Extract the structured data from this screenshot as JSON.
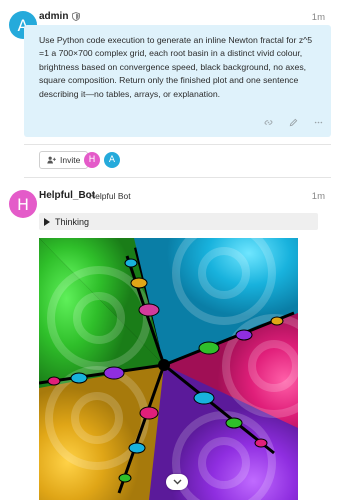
{
  "post1": {
    "avatar_letter": "A",
    "username": "admin",
    "time": "1m",
    "text": "Use Python code execution to generate an inline Newton fractal for z^5 =1 a 700×700 complex grid, each root basin in a distinct vivid colour, brightness based on convergence speed, black background, no axes, square composition. Return only the finished plot and one sentence describing it—no tables, arrays, or explanation."
  },
  "topic_controls": {
    "invite_label": "Invite",
    "participants": [
      "H",
      "A"
    ]
  },
  "post2": {
    "avatar_letter": "H",
    "username": "Helpful_Bot",
    "user_title": "Helpful Bot",
    "time": "1m",
    "thinking_label": "Thinking"
  },
  "colors": {
    "admin_avatar": "#25aadb",
    "bot_avatar": "#e45bc9",
    "bubble": "#dff2fb"
  },
  "icons": [
    "shield-icon",
    "link-icon",
    "edit-icon",
    "more-icon",
    "user-plus-icon",
    "triangle-right-icon",
    "chevron-down-icon"
  ]
}
